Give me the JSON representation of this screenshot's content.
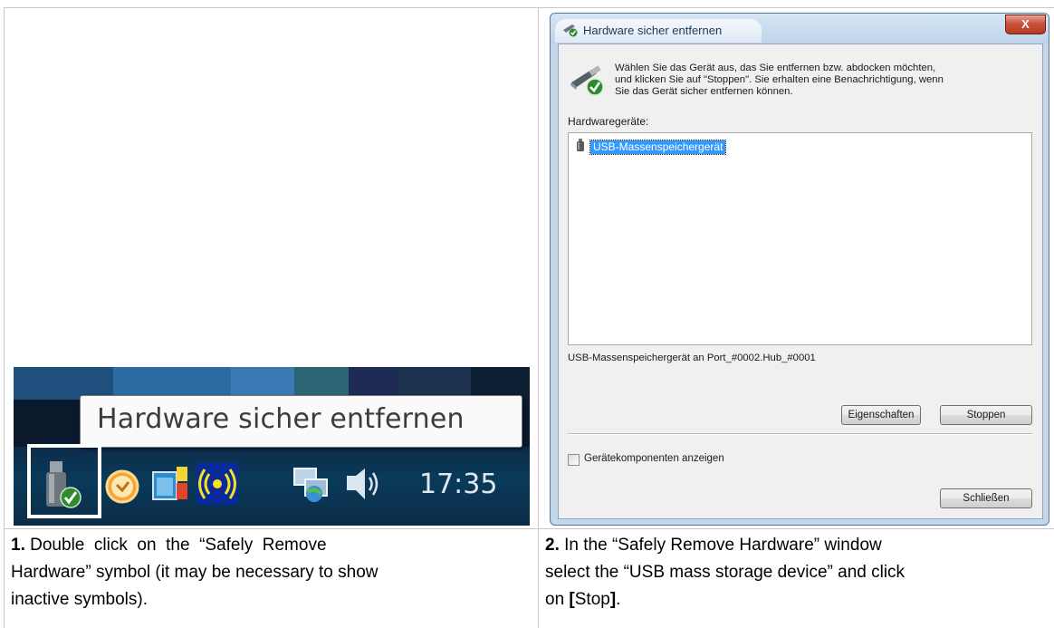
{
  "taskbar": {
    "tooltip_text": "Hardware sicher entfernen",
    "clock": "17:35",
    "icons": [
      "safely-remove-hardware-icon",
      "clock-app-icon",
      "windows-sidebar-icon",
      "wireless-icon",
      "network-icon",
      "volume-icon"
    ]
  },
  "dialog": {
    "title": "Hardware sicher entfernen",
    "close_label": "X",
    "intro_line1": "Wählen Sie das Gerät aus, das Sie entfernen bzw. abdocken möchten,",
    "intro_line2": "und klicken Sie auf \"Stoppen\". Sie erhalten eine Benachrichtigung, wenn",
    "intro_line3": "Sie das Gerät sicher entfernen können.",
    "devices_label": "Hardwaregeräte:",
    "devices": [
      "USB-Massenspeichergerät"
    ],
    "device_info": "USB-Massenspeichergerät an Port_#0002.Hub_#0001",
    "properties_button": "Eigenschaften",
    "stop_button": "Stoppen",
    "show_components_label": "Gerätekomponenten anzeigen",
    "show_components_checked": false,
    "close_button": "Schließen"
  },
  "captions": {
    "step1": {
      "number": "1.",
      "line1": "Double  click  on  the  “Safely  Remove",
      "line2": "Hardware” symbol (it may be necessary to show",
      "line3": "inactive symbols)."
    },
    "step2": {
      "number": "2.",
      "line1": "In the “Safely Remove Hardware” window",
      "line2": "select the “USB mass storage device” and click",
      "line3_pre": "on ",
      "line3_open": "[",
      "line3_mid": "Stop",
      "line3_close": "]",
      "line3_post": "."
    }
  },
  "colors": {
    "selection": "#3399ff",
    "dialog_frame": "#c3d7ea",
    "taskbar": "#0a3a5a",
    "close_button": "#c9523b"
  }
}
